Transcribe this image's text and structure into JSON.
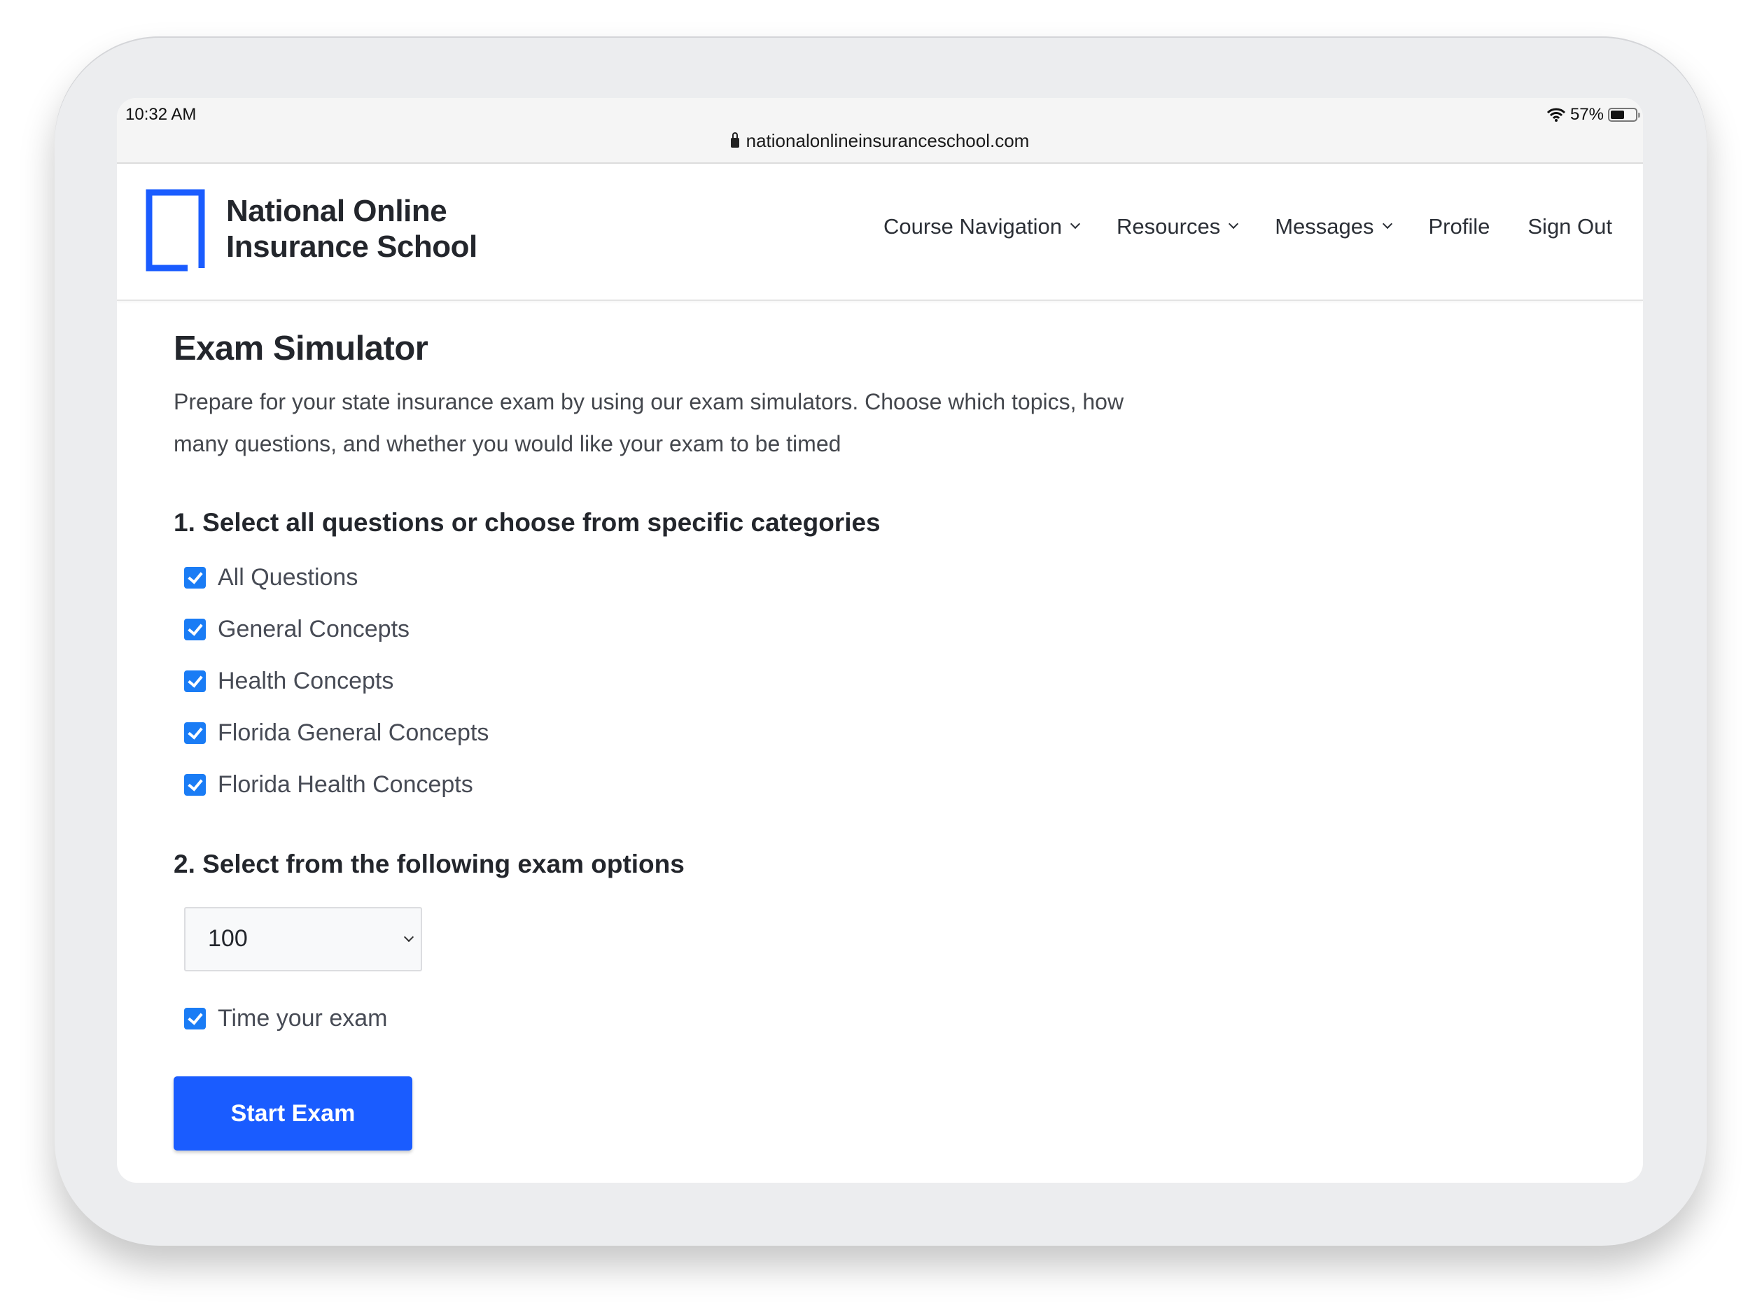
{
  "status_bar": {
    "time": "10:32 AM",
    "url": "nationalonlineinsuranceschool.com",
    "battery_percent_label": "57%",
    "battery_level": 0.57
  },
  "header": {
    "logo_line1": "National Online",
    "logo_line2": "Insurance School",
    "brand_color": "#1a5cff",
    "nav": [
      {
        "label": "Course Navigation",
        "has_dropdown": true
      },
      {
        "label": "Resources",
        "has_dropdown": true
      },
      {
        "label": "Messages",
        "has_dropdown": true
      },
      {
        "label": "Profile",
        "has_dropdown": false
      },
      {
        "label": "Sign Out",
        "has_dropdown": false
      }
    ]
  },
  "main": {
    "title": "Exam Simulator",
    "description": "Prepare for your state insurance exam by using our exam simulators. Choose which topics, how many questions, and whether you would like your exam to be timed",
    "section1_heading": "1. Select all questions or choose from specific categories",
    "categories": [
      {
        "label": "All Questions",
        "checked": true
      },
      {
        "label": "General Concepts",
        "checked": true
      },
      {
        "label": "Health Concepts",
        "checked": true
      },
      {
        "label": "Florida General Concepts",
        "checked": true
      },
      {
        "label": "Florida Health Concepts",
        "checked": true
      }
    ],
    "section2_heading": "2. Select from the following exam options",
    "question_count_selected": "100",
    "time_exam_label": "Time your exam",
    "time_exam_checked": true,
    "start_button_label": "Start Exam"
  }
}
